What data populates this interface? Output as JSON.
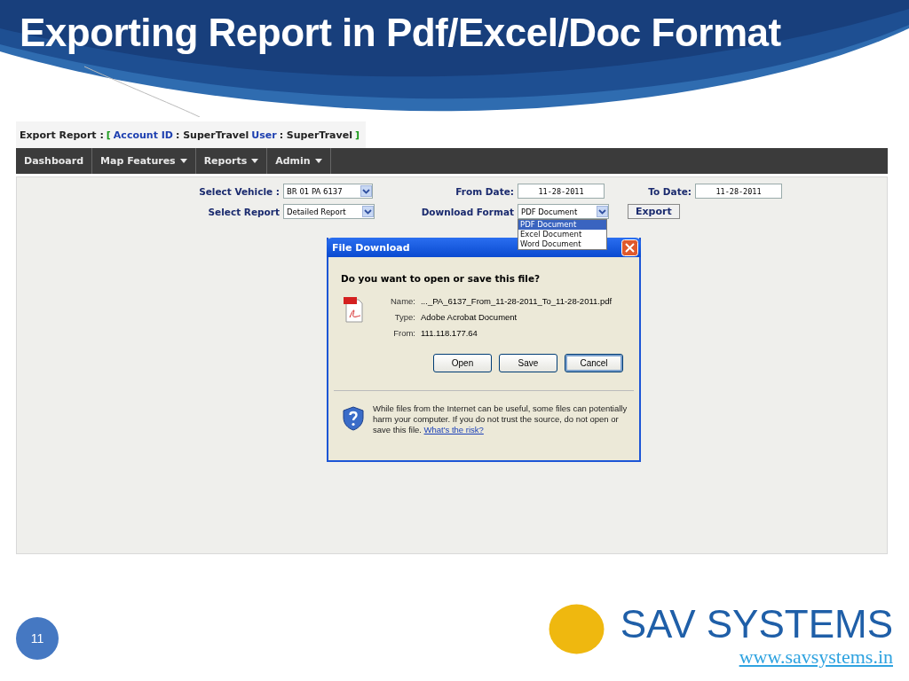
{
  "slide": {
    "title": "Exporting Report in Pdf/Excel/Doc Format",
    "page_number": "11"
  },
  "app": {
    "heading": [
      {
        "kind": "label",
        "text": "Export Report :"
      },
      {
        "kind": "bracket",
        "text": "["
      },
      {
        "kind": "key",
        "text": "Account ID"
      },
      {
        "kind": "value",
        "text": ": SuperTravel"
      },
      {
        "kind": "key",
        "text": "User"
      },
      {
        "kind": "value",
        "text": ": SuperTravel"
      },
      {
        "kind": "bracket",
        "text": "]"
      }
    ],
    "menu": [
      {
        "label": "Dashboard",
        "has_dropdown": false
      },
      {
        "label": "Map Features",
        "has_dropdown": true
      },
      {
        "label": "Reports",
        "has_dropdown": true
      },
      {
        "label": "Admin",
        "has_dropdown": true
      }
    ],
    "form": {
      "select_vehicle": {
        "label": "Select Vehicle :",
        "value": "BR 01 PA 6137"
      },
      "from_date": {
        "label": "From Date:",
        "value": "11-28-2011"
      },
      "to_date": {
        "label": "To Date:",
        "value": "11-28-2011"
      },
      "select_report": {
        "label": "Select Report",
        "value": "Detailed Report"
      },
      "download_format": {
        "label": "Download Format",
        "value": "PDF Document",
        "expanded": true,
        "options": [
          {
            "label": "PDF Document",
            "selected": true
          },
          {
            "label": "Excel Document",
            "selected": false
          },
          {
            "label": "Word Document",
            "selected": false
          }
        ]
      },
      "export_button": "Export"
    },
    "dialog": {
      "title": "File Download",
      "question": "Do you want to open or save this file?",
      "details": [
        {
          "label": "Name:",
          "value": "..._PA_6137_From_11-28-2011_To_11-28-2011.pdf"
        },
        {
          "label": "Type:",
          "value": "Adobe Acrobat Document"
        },
        {
          "label": "From:",
          "value": "111.118.177.64"
        }
      ],
      "buttons": [
        {
          "label": "Open",
          "focused": false
        },
        {
          "label": "Save",
          "focused": false
        },
        {
          "label": "Cancel",
          "focused": true
        }
      ],
      "warning": "While files from the Internet can be useful, some files can potentially harm your computer. If you do not trust the source, do not open or save this file.",
      "warning_link": "What's the risk?"
    }
  },
  "footer": {
    "brand": "SAV SYSTEMS",
    "url": "www.savsystems.in"
  }
}
